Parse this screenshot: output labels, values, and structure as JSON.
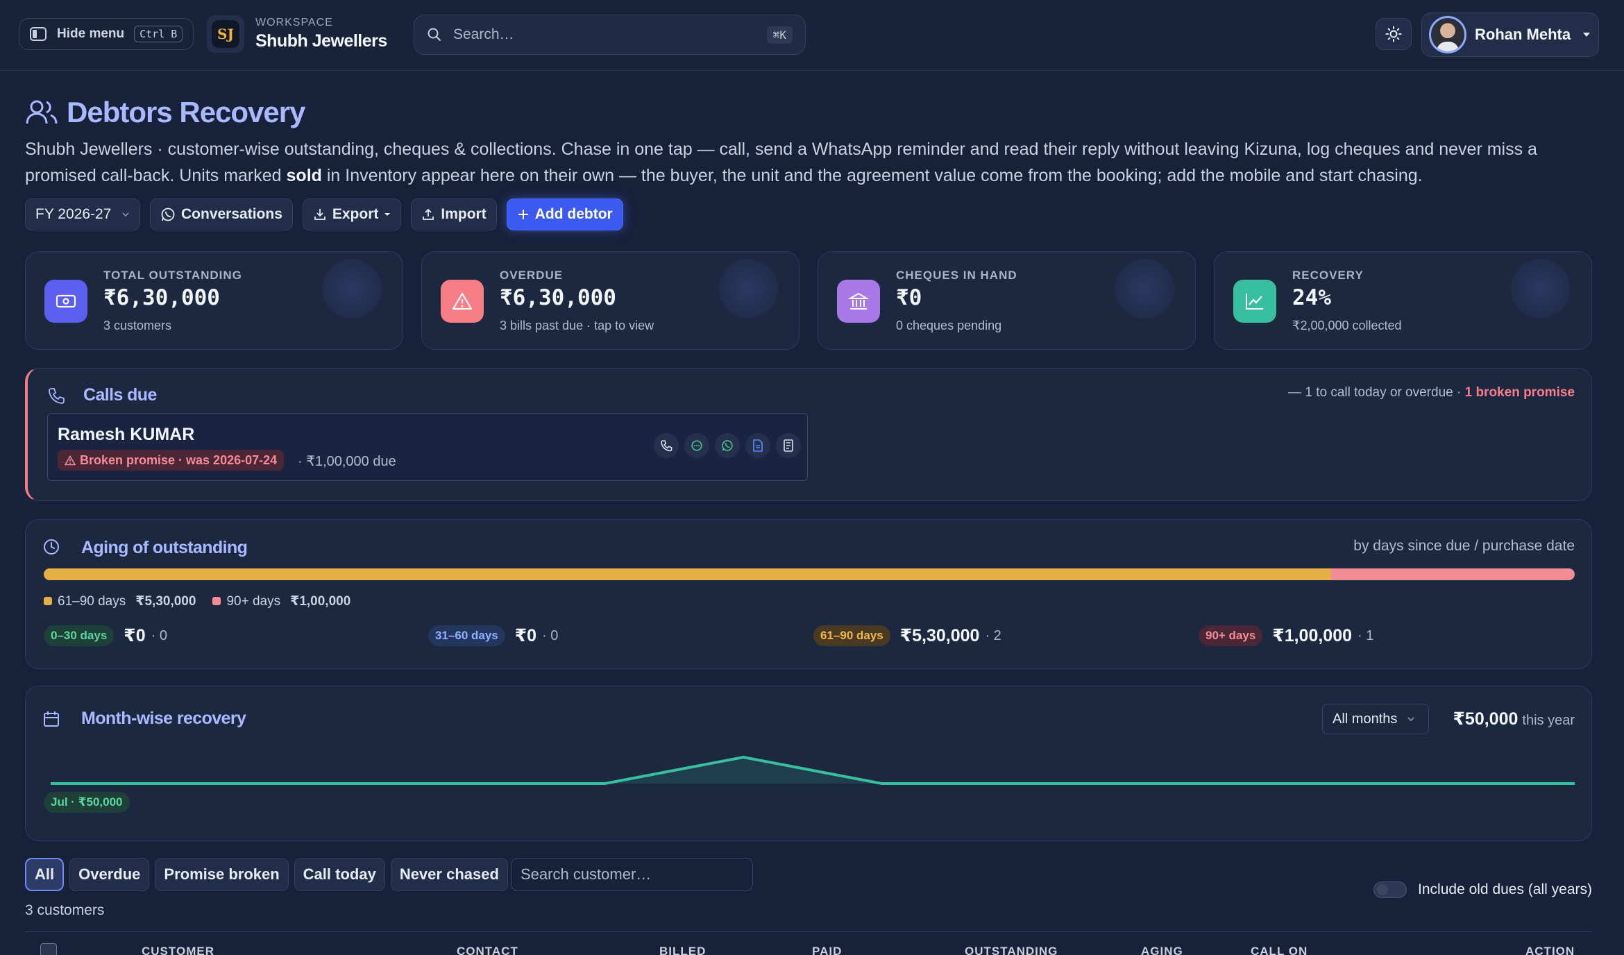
{
  "topbar": {
    "hide_menu_label": "Hide menu",
    "hide_menu_shortcut": "Ctrl B",
    "workspace_logo": "SJ",
    "workspace_label": "WORKSPACE",
    "workspace_name": "Shubh Jewellers",
    "search_placeholder": "Search…",
    "search_shortcut": "⌘K",
    "user_name": "Rohan Mehta"
  },
  "page": {
    "title": "Debtors Recovery",
    "description_before_bold": "Shubh Jewellers · customer-wise outstanding, cheques & collections. Chase in one tap — call, send a WhatsApp reminder and read their reply without leaving Kizuna, log cheques and never miss a promised call-back. Units marked ",
    "description_bold": "sold",
    "description_after_bold": " in Inventory appear here on their own — the buyer, the unit and the agreement value come from the booking; add the mobile and start chasing."
  },
  "actions": {
    "fy": "FY 2026-27",
    "conversations": "Conversations",
    "export": "Export",
    "import": "Import",
    "add_debtor": "Add debtor"
  },
  "stats": [
    {
      "label": "TOTAL OUTSTANDING",
      "value": "₹6,30,000",
      "sub": "3 customers",
      "icon": "cash-icon",
      "color": "#5b5ff0"
    },
    {
      "label": "OVERDUE",
      "value": "₹6,30,000",
      "sub": "3 bills past due · tap to view",
      "icon": "warning-icon",
      "color": "#f77d86"
    },
    {
      "label": "CHEQUES IN HAND",
      "value": "₹0",
      "sub": "0 cheques pending",
      "icon": "bank-icon",
      "color": "#a878e6"
    },
    {
      "label": "RECOVERY",
      "value": "24%",
      "sub": "₹2,00,000 collected",
      "icon": "trend-icon",
      "color": "#38bfa0"
    }
  ],
  "calls": {
    "title": "Calls due",
    "meta_prefix": "— 1 to call today or overdue",
    "meta_broken": "1 broken promise",
    "debtor": {
      "name": "Ramesh KUMAR",
      "badge": "Broken promise · was 2026-07-24",
      "due": "· ₹1,00,000 due"
    }
  },
  "aging": {
    "title": "Aging of outstanding",
    "meta": "by days since due / purchase date",
    "bar": [
      {
        "fraction": 0.841,
        "color": "#e6ae47"
      },
      {
        "fraction": 0.159,
        "color": "#f48c96"
      }
    ],
    "legend": [
      {
        "label": "61–90 days",
        "amount": "₹5,30,000",
        "color": "#e6ae47"
      },
      {
        "label": "90+ days",
        "amount": "₹1,00,000",
        "color": "#f48c96"
      }
    ],
    "buckets": [
      {
        "label": "0–30 days",
        "amount": "₹0",
        "count": "· 0",
        "bg": "#1e4038",
        "fg": "#5bd6a2"
      },
      {
        "label": "31–60 days",
        "amount": "₹0",
        "count": "· 0",
        "bg": "#24355e",
        "fg": "#8eb2ff"
      },
      {
        "label": "61–90 days",
        "amount": "₹5,30,000",
        "count": "· 2",
        "bg": "#4a3a22",
        "fg": "#f2b84f"
      },
      {
        "label": "90+ days",
        "amount": "₹1,00,000",
        "count": "· 1",
        "bg": "#4a2636",
        "fg": "#f58b97"
      }
    ]
  },
  "month": {
    "title": "Month-wise recovery",
    "select": "All months",
    "total": "₹50,000",
    "total_suffix": "this year",
    "tag": "Jul · ₹50,000",
    "series": [
      0,
      0,
      0,
      0,
      0,
      50000,
      0,
      0,
      0,
      0,
      0,
      0
    ]
  },
  "filters": {
    "chips": [
      "All",
      "Overdue",
      "Promise broken",
      "Call today",
      "Never chased"
    ],
    "active": "All",
    "search_placeholder": "Search customer…",
    "old_dues_label": "Include old dues (all years)",
    "count_text": "3 customers"
  },
  "table": {
    "headers": [
      "CUSTOMER",
      "CONTACT",
      "BILLED",
      "PAID",
      "OUTSTANDING",
      "AGING",
      "CALL ON",
      "ACTION"
    ]
  }
}
